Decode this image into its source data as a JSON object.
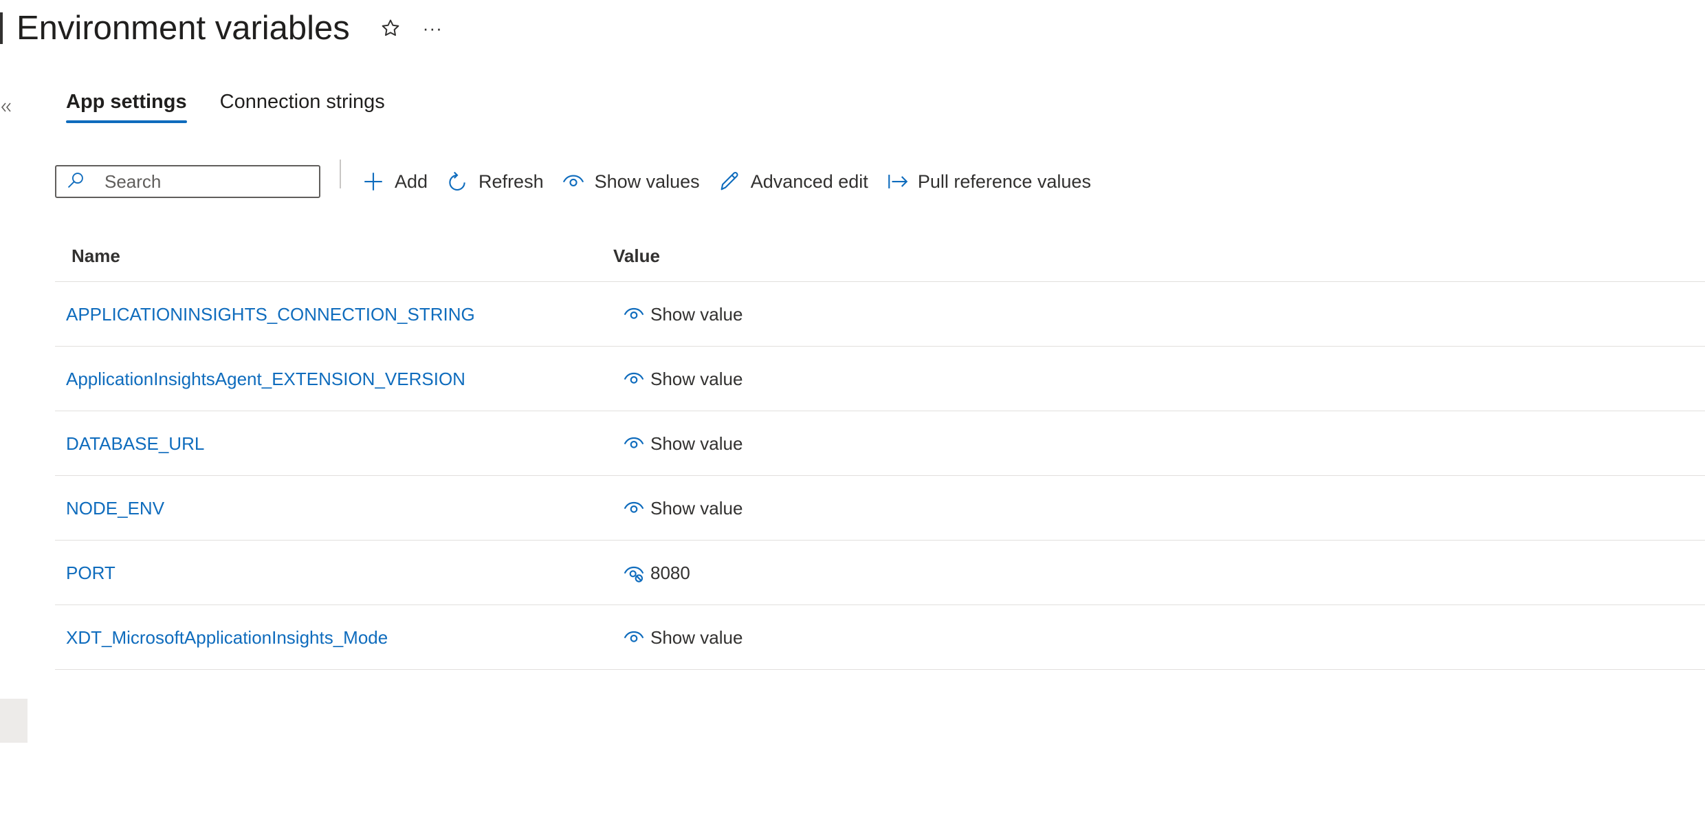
{
  "header": {
    "title": "Environment variables",
    "favorite_icon": "star-icon",
    "more_icon": "more-icon",
    "more_label": "···"
  },
  "sidebar": {
    "collapse_icon": "double-chevron-left-icon"
  },
  "tabs": [
    {
      "label": "App settings",
      "active": true
    },
    {
      "label": "Connection strings",
      "active": false
    }
  ],
  "toolbar": {
    "search_placeholder": "Search",
    "search_value": "",
    "buttons": [
      {
        "label": "Add",
        "icon": "plus-icon"
      },
      {
        "label": "Refresh",
        "icon": "refresh-icon"
      },
      {
        "label": "Show values",
        "icon": "eye-icon"
      },
      {
        "label": "Advanced edit",
        "icon": "pencil-icon"
      },
      {
        "label": "Pull reference values",
        "icon": "pull-arrow-icon"
      }
    ]
  },
  "table": {
    "columns": [
      "Name",
      "Value"
    ],
    "rows": [
      {
        "name": "APPLICATIONINSIGHTS_CONNECTION_STRING",
        "value": "Show value",
        "icon": "eye-icon"
      },
      {
        "name": "ApplicationInsightsAgent_EXTENSION_VERSION",
        "value": "Show value",
        "icon": "eye-icon"
      },
      {
        "name": "DATABASE_URL",
        "value": "Show value",
        "icon": "eye-icon"
      },
      {
        "name": "NODE_ENV",
        "value": "Show value",
        "icon": "eye-icon"
      },
      {
        "name": "PORT",
        "value": "8080",
        "icon": "eye-hide-icon"
      },
      {
        "name": "XDT_MicrosoftApplicationInsights_Mode",
        "value": "Show value",
        "icon": "eye-icon"
      }
    ]
  },
  "colors": {
    "accent": "#0f6cbd",
    "text": "#323130",
    "divider": "#e1dfdd"
  }
}
